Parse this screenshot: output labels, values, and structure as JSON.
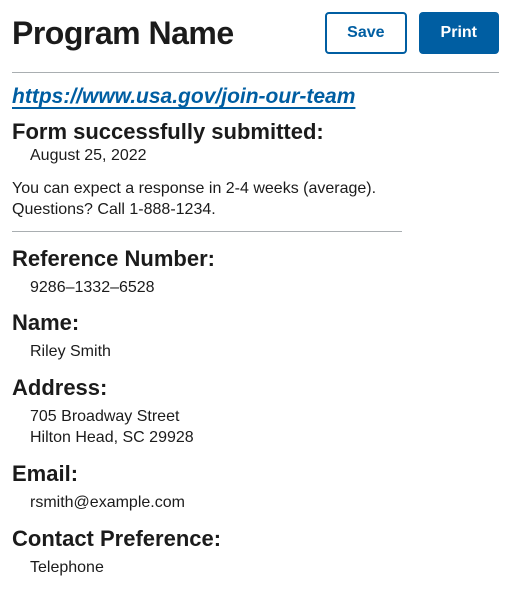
{
  "header": {
    "title": "Program Name",
    "saveLabel": "Save",
    "printLabel": "Print"
  },
  "link": {
    "url": "https://www.usa.gov/join-our-team"
  },
  "intro": {
    "heading": "Form successfully submitted:",
    "date": "August 25, 2022",
    "line1": "You can expect a response in 2-4 weeks (average).",
    "line2": "Questions? Call 1-888-1234."
  },
  "fields": {
    "ref": {
      "label": "Reference Number:",
      "value": "9286–1332–6528"
    },
    "name": {
      "label": "Name:",
      "value": "Riley Smith"
    },
    "address": {
      "label": "Address:",
      "line1": "705 Broadway Street",
      "line2": "Hilton Head, SC 29928"
    },
    "email": {
      "label": "Email:",
      "value": "rsmith@example.com"
    },
    "contact": {
      "label": "Contact Preference:",
      "value": "Telephone"
    }
  }
}
